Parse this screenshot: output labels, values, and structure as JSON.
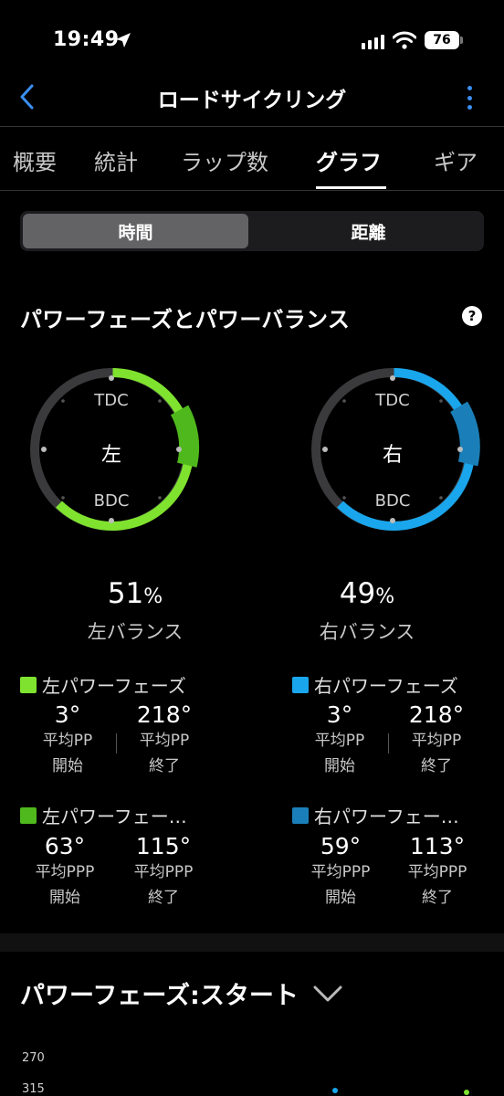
{
  "status": {
    "time": "19:49",
    "battery": "76"
  },
  "nav": {
    "title": "ロードサイクリング",
    "back_icon": "chevron-left-icon",
    "more_icon": "more-vertical-icon"
  },
  "tabs": [
    {
      "label": "概要"
    },
    {
      "label": "統計"
    },
    {
      "label": "ラップ数"
    },
    {
      "label": "グラフ",
      "active": true
    },
    {
      "label": "ギア"
    }
  ],
  "segment": {
    "time": "時間",
    "distance": "距離"
  },
  "power_section": {
    "title": "パワーフェーズとパワーバランス",
    "help": "?",
    "tdc": "TDC",
    "bdc": "BDC",
    "left": {
      "side": "左",
      "balance_value": "51",
      "balance_unit": "%",
      "balance_label": "左バランス",
      "color_phase": "#7fe22f",
      "color_peak": "#4fb81c",
      "phase_title": "左パワーフェーズ",
      "phase_start": "3°",
      "phase_end": "218°",
      "peak_title": "左パワーフェー…",
      "peak_start": "63°",
      "peak_end": "115°"
    },
    "right": {
      "side": "右",
      "balance_value": "49",
      "balance_unit": "%",
      "balance_label": "右バランス",
      "color_phase": "#1aa6ec",
      "color_peak": "#1a7fb8",
      "phase_title": "右パワーフェーズ",
      "phase_start": "3°",
      "phase_end": "218°",
      "peak_title": "右パワーフェー…",
      "peak_start": "59°",
      "peak_end": "113°"
    },
    "labels": {
      "avg_pp": "平均PP",
      "avg_ppp": "平均PPP",
      "start": "開始",
      "end": "終了"
    }
  },
  "section2": {
    "title": "パワーフェーズ:スタート",
    "ticks": [
      "270",
      "315"
    ]
  }
}
